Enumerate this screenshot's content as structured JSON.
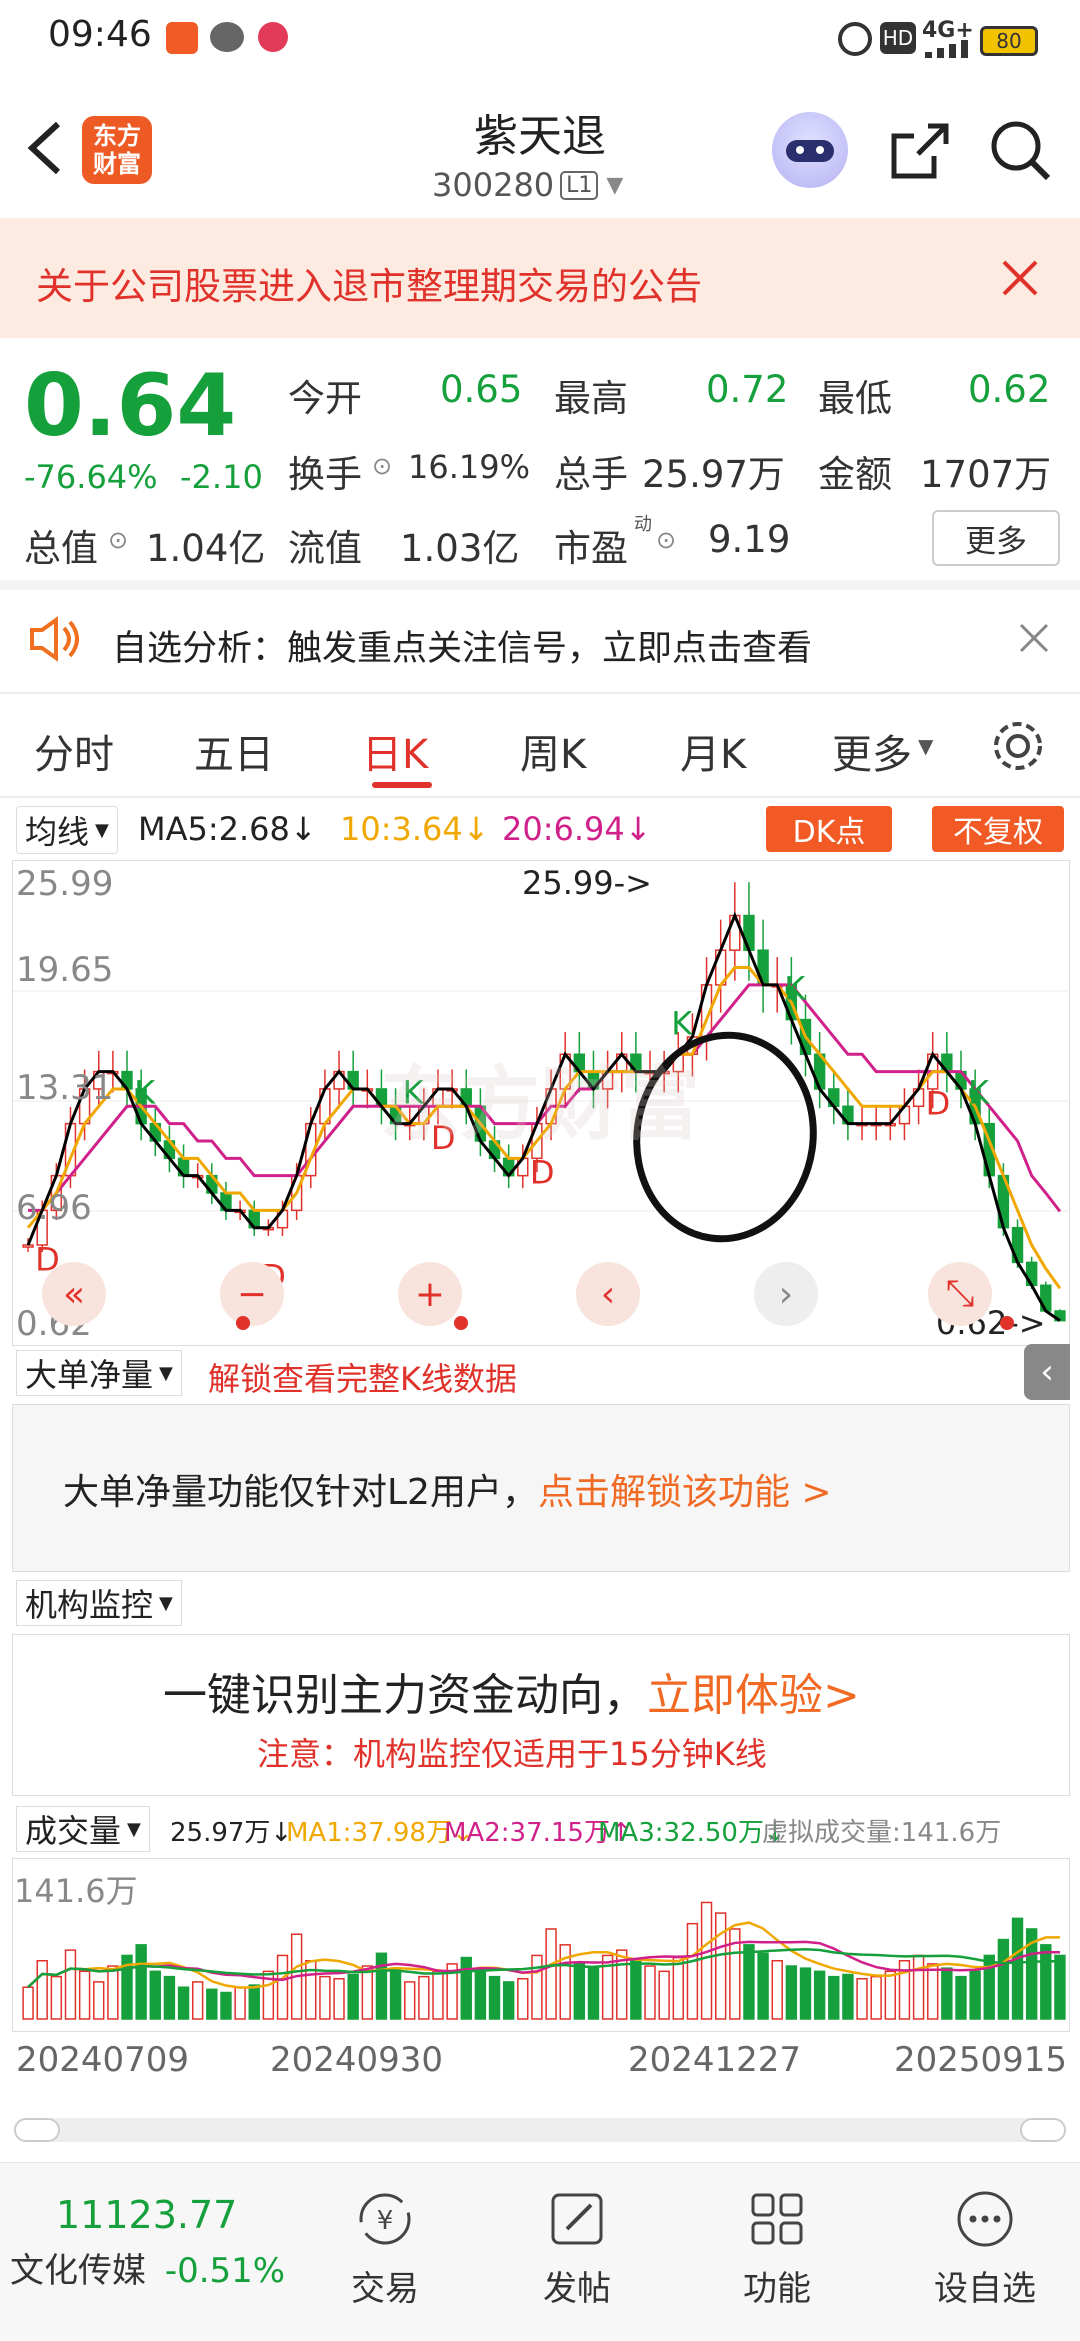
{
  "status": {
    "time": "09:46",
    "signal": "4G+",
    "battery": "80"
  },
  "header": {
    "logo_top": "东方",
    "logo_bottom": "财富",
    "title": "紫天退",
    "code": "300280",
    "level": "L1"
  },
  "notice": {
    "text": "关于公司股票进入退市整理期交易的公告"
  },
  "quote": {
    "price": "0.64",
    "change_pct": "-76.64%",
    "change": "-2.10",
    "open_label": "今开",
    "open": "0.65",
    "high_label": "最高",
    "high": "0.72",
    "low_label": "最低",
    "low": "0.62",
    "turnover_label": "换手",
    "turnover": "16.19%",
    "volume_label": "总手",
    "volume": "25.97万",
    "amount_label": "金额",
    "amount": "1707万",
    "mktcap_label": "总值",
    "mktcap": "1.04亿",
    "float_label": "流值",
    "float": "1.03亿",
    "pe_label": "市盈",
    "pe_sup": "动",
    "pe": "9.19",
    "more": "更多"
  },
  "analysis": {
    "text": "自选分析：触发重点关注信号，立即点击查看"
  },
  "tabs": [
    "分时",
    "五日",
    "日K",
    "周K",
    "月K",
    "更多"
  ],
  "active_tab": "日K",
  "kline": {
    "ma_selector": "均线",
    "ma5": "MA5:2.68↓",
    "ma10": "10:3.64↓",
    "ma20": "20:6.94↓",
    "dk_btn": "DK点",
    "fq_btn": "不复权",
    "y_labels": [
      "25.99",
      "19.65",
      "13.31",
      "6.96",
      "0.62"
    ],
    "max_label": "25.99->",
    "min_label": "0.62->",
    "watermark": "东方财富"
  },
  "bigorder": {
    "selector": "大单净量",
    "unlock": "解锁查看完整K线数据",
    "msg": "大单净量功能仅针对L2用户，",
    "link": "点击解锁该功能 >"
  },
  "inst": {
    "selector": "机构监控",
    "msg": "一键识别主力资金动向，",
    "link": "立即体验>",
    "note": "注意：机构监控仅适用于15分钟K线"
  },
  "vol": {
    "selector": "成交量",
    "v": "25.97万↓",
    "ma1": "MA1:37.98万↓",
    "ma2": "MA2:37.15万↑",
    "ma3": "MA3:32.50万↓",
    "virtual": "虚拟成交量:141.6万",
    "max": "141.6万"
  },
  "dates": [
    "20240709",
    "20240930",
    "20241227",
    "20250915"
  ],
  "bottom": {
    "index_value": "11123.77",
    "index_name": "文化传媒",
    "index_change": "-0.51%",
    "trade": "交易",
    "post": "发帖",
    "func": "功能",
    "watch": "设自选"
  },
  "colors": {
    "up": "#e0322a",
    "down": "#15a03c",
    "accent": "#ff6a00",
    "ma5": "#000000",
    "ma10": "#f0a800",
    "ma20": "#d0208a"
  },
  "chart_data": {
    "type": "candlestick",
    "ylim": [
      0.62,
      25.99
    ],
    "ma5_close": [
      5,
      7,
      9,
      12,
      14,
      15,
      15,
      14,
      12,
      11,
      10,
      9,
      9,
      8,
      7,
      7,
      6,
      6,
      7,
      9,
      12,
      14,
      15,
      14,
      14,
      13,
      12,
      12,
      13,
      14,
      14,
      13,
      11,
      10,
      9,
      10,
      12,
      14,
      16,
      15,
      14,
      15,
      16,
      15,
      15,
      15,
      16,
      17,
      20,
      22,
      24,
      22,
      20,
      20,
      18,
      16,
      14,
      13,
      12,
      12,
      12,
      12,
      13,
      14,
      16,
      15,
      14,
      12,
      9,
      6,
      4,
      2.68,
      1.2,
      0.64
    ],
    "ma10": [
      6,
      7,
      8,
      10,
      12,
      13,
      14,
      14,
      13,
      12,
      11,
      10,
      10,
      9,
      8,
      8,
      7,
      7,
      7,
      8,
      10,
      12,
      13,
      14,
      14,
      13,
      13,
      12,
      12,
      13,
      13,
      13,
      12,
      11,
      10,
      10,
      11,
      12,
      14,
      15,
      15,
      15,
      15,
      15,
      15,
      15,
      16,
      16,
      18,
      20,
      21,
      21,
      20,
      20,
      19,
      17,
      16,
      15,
      14,
      13,
      13,
      13,
      13,
      14,
      15,
      15,
      14,
      13,
      11,
      9,
      7,
      5,
      3.64,
      2.5
    ],
    "ma20": [
      7,
      7,
      8,
      9,
      10,
      11,
      12,
      13,
      13,
      13,
      12,
      12,
      11,
      11,
      10,
      10,
      9,
      9,
      9,
      9,
      10,
      11,
      12,
      13,
      13,
      13,
      13,
      13,
      13,
      13,
      13,
      13,
      13,
      12,
      12,
      12,
      12,
      13,
      13,
      14,
      14,
      15,
      15,
      15,
      15,
      15,
      16,
      16,
      17,
      18,
      19,
      20,
      20,
      20,
      20,
      19,
      18,
      17,
      16,
      16,
      15,
      15,
      15,
      15,
      15,
      15,
      15,
      14,
      13,
      12,
      11,
      9,
      8,
      6.94
    ],
    "d_markers": [
      "D",
      "D",
      "D",
      "D",
      "D"
    ],
    "k_markers": [
      "K",
      "K",
      "K",
      "K",
      "K"
    ],
    "volume": [
      30,
      55,
      40,
      65,
      45,
      35,
      50,
      60,
      70,
      45,
      40,
      30,
      35,
      28,
      25,
      30,
      32,
      45,
      60,
      80,
      55,
      40,
      38,
      42,
      50,
      62,
      48,
      35,
      40,
      45,
      52,
      58,
      47,
      40,
      35,
      38,
      60,
      85,
      70,
      52,
      48,
      60,
      65,
      55,
      50,
      45,
      58,
      90,
      110,
      100,
      85,
      70,
      62,
      55,
      50,
      48,
      45,
      40,
      42,
      38,
      40,
      45,
      55,
      60,
      52,
      48,
      40,
      45,
      60,
      75,
      95,
      85,
      70,
      60
    ],
    "vol_ylim": [
      0,
      141.6
    ]
  }
}
